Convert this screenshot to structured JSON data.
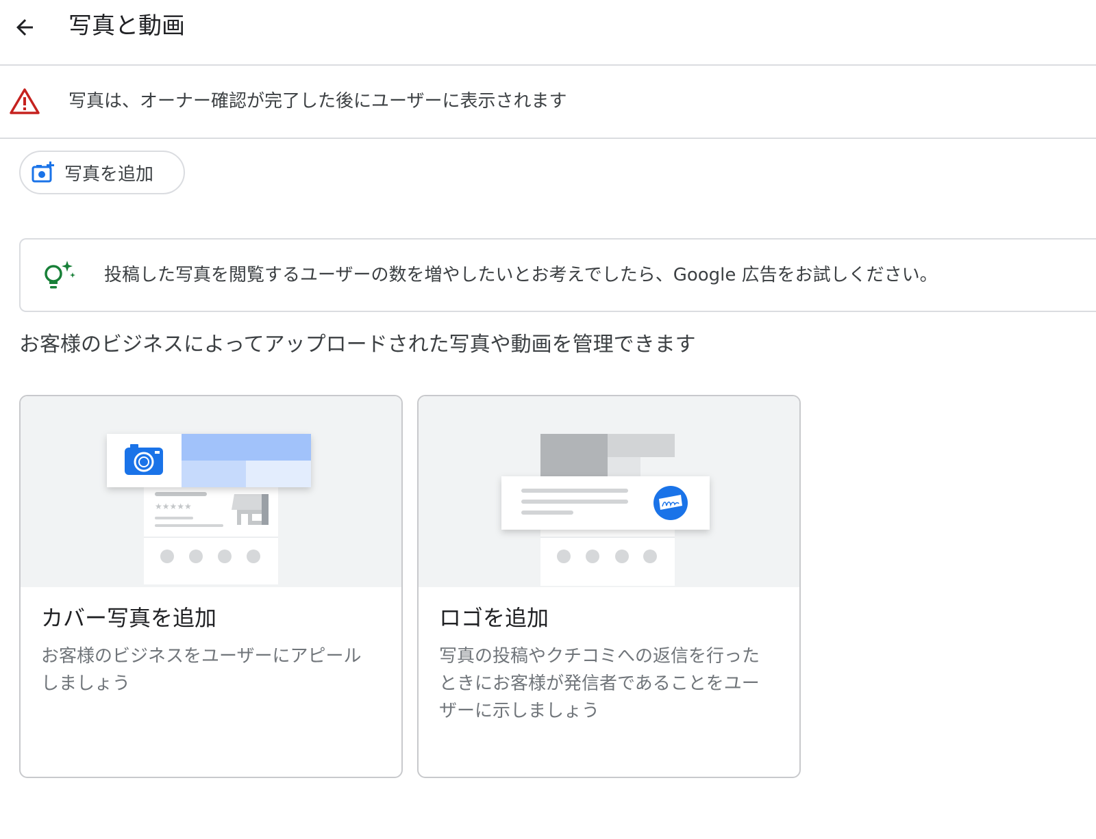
{
  "header": {
    "title": "写真と動画",
    "back_icon": "arrow-back-icon"
  },
  "warning": {
    "icon": "warning-triangle-icon",
    "color": "#c5221f",
    "text": "写真は、オーナー確認が完了した後にユーザーに表示されます"
  },
  "add_photo": {
    "icon": "add-photo-camera-icon",
    "label": "写真を追加",
    "accent": "#1a73e8"
  },
  "tip": {
    "icon": "lightbulb-sparkle-icon",
    "color": "#188038",
    "text": "投稿した写真を閲覧するユーザーの数を増やしたいとお考えでしたら、Google 広告をお試しください。"
  },
  "section": {
    "description": "お客様のビジネスによってアップロードされた写真や動画を管理できます"
  },
  "cards": [
    {
      "id": "cover",
      "title": "カバー写真を追加",
      "description": "お客様のビジネスをユーザーにアピールしましょう",
      "illustration_icon": "camera-icon"
    },
    {
      "id": "logo",
      "title": "ロゴを追加",
      "description": "写真の投稿やクチコミへの返信を行ったときにお客様が発信者であることをユーザーに示しましょう",
      "illustration_icon": "signature-badge-icon"
    }
  ]
}
